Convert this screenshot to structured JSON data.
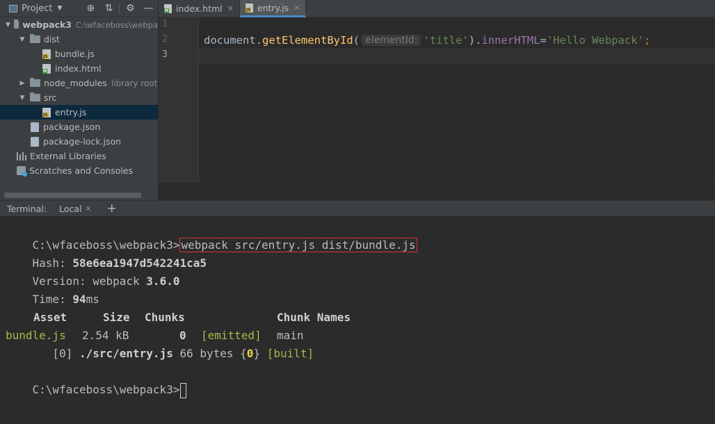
{
  "project_panel": {
    "title": "Project",
    "tree": {
      "root": {
        "name": "webpack3",
        "path": "C:\\wfaceboss\\webpa"
      },
      "dist": "dist",
      "bundle": "bundle.js",
      "index": "index.html",
      "node_modules": "node_modules",
      "node_modules_hint": "library root",
      "src": "src",
      "entry": "entry.js",
      "package": "package.json",
      "package_lock": "package-lock.json",
      "external": "External Libraries",
      "scratches": "Scratches and Consoles"
    },
    "header_icons": [
      "crosshair-icon",
      "collapse-icon",
      "gear-icon",
      "minimize-icon"
    ]
  },
  "editor": {
    "tabs": [
      {
        "label": "index.html",
        "active": false
      },
      {
        "label": "entry.js",
        "active": true
      }
    ],
    "line_numbers": [
      "1",
      "2",
      "3"
    ],
    "code": {
      "obj": "document",
      "dot1": ".",
      "fn": "getElementById",
      "paren_open": "(",
      "param_hint": "elementId:",
      "arg": "'title'",
      "paren_close": ")",
      "dot2": ".",
      "prop": "innerHTML",
      "eq": "=",
      "value": "'Hello Webpack'",
      "semi": ";"
    },
    "colors": {
      "identifier": "#a9b7c6",
      "function": "#ffc66d",
      "property": "#9876aa",
      "string": "#6a8759",
      "keyword": "#cc7832"
    }
  },
  "terminal": {
    "label": "Terminal:",
    "tab": "Local",
    "add_button": "+",
    "prompt": "C:\\wfaceboss\\webpack3>",
    "command": "webpack src/entry.js dist/bundle.js",
    "hash_label": "Hash: ",
    "hash": "58e6ea1947d542241ca5",
    "version_label": "Version: webpack ",
    "version": "3.6.0",
    "time_label": "Time: ",
    "time": "94",
    "time_unit": "ms",
    "table": {
      "headers": {
        "asset": "Asset",
        "size": "Size",
        "chunks": "Chunks",
        "chunk_names": "Chunk Names"
      },
      "row": {
        "asset": "bundle.js",
        "size": "2.54 kB",
        "chunks": "0",
        "status": "[emitted]",
        "name": "main"
      }
    },
    "module_line": {
      "prefix": "   [0] ",
      "path": "./src/entry.js",
      "size": " 66 bytes {",
      "chunk": "0",
      "close": "} ",
      "status": "[built]"
    },
    "prompt2": "C:\\wfaceboss\\webpack3>",
    "highlight_color": "#d03a3a"
  }
}
